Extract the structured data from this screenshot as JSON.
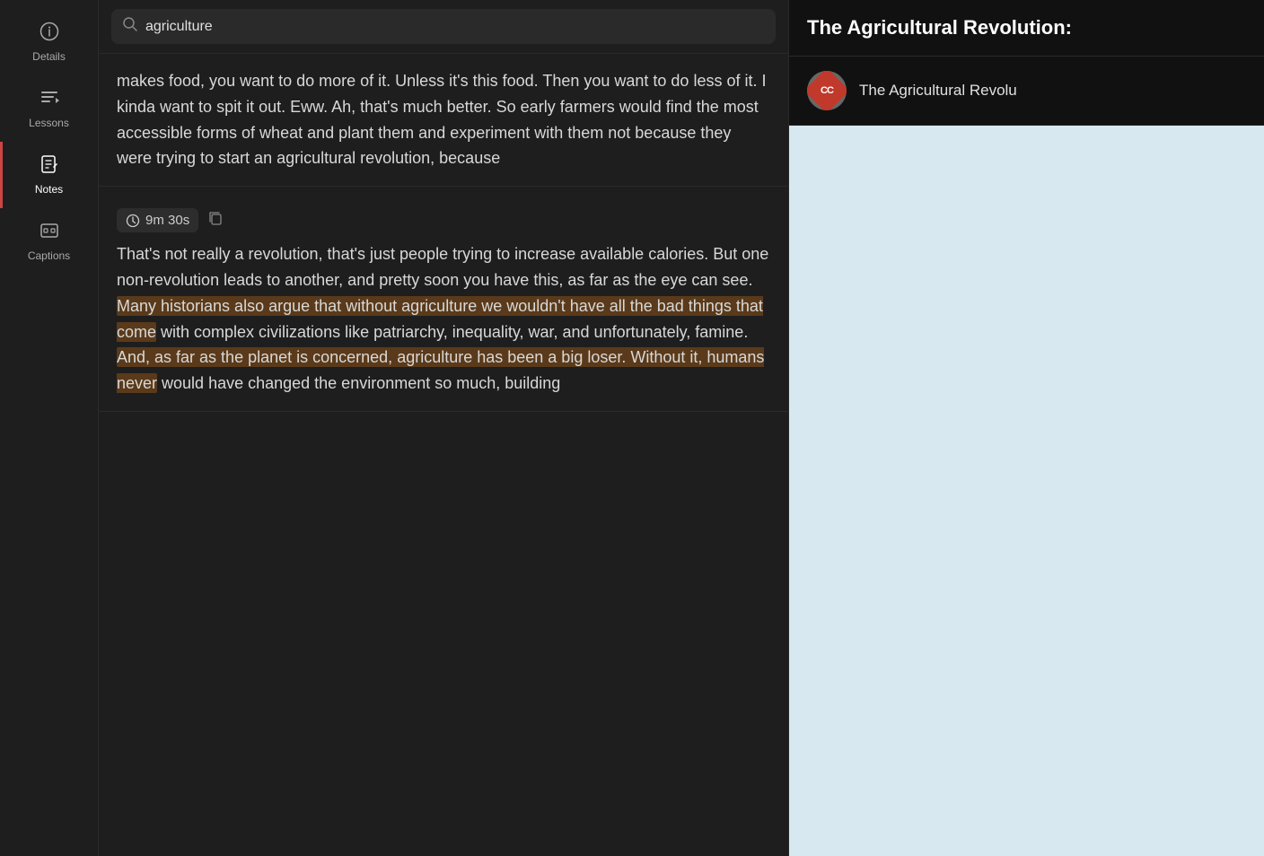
{
  "sidebar": {
    "items": [
      {
        "id": "details",
        "label": "Details",
        "icon": "ℹ",
        "active": false
      },
      {
        "id": "lessons",
        "label": "Lessons",
        "icon": "♫",
        "active": false
      },
      {
        "id": "notes",
        "label": "Notes",
        "icon": "🗒",
        "active": true
      },
      {
        "id": "captions",
        "label": "Captions",
        "icon": "⊟",
        "active": false
      }
    ]
  },
  "search": {
    "placeholder": "agriculture",
    "value": "agriculture"
  },
  "notes": [
    {
      "id": "note1",
      "text": "makes food, you want to do more of it. Unless it's this food. Then you want to do less of it. I kinda want to spit it out. Eww. Ah, that's much better. So early farmers would find the most accessible forms of wheat and plant them and experiment with them not because they were trying to start an agricultural revolution, because",
      "highlighted": false,
      "has_timestamp": false
    },
    {
      "id": "note2",
      "timestamp": "9m 30s",
      "text": "That's not really a revolution, that's just people trying to increase available calories. But one non-revolution leads to another, and pretty soon you have this, as far as the eye can see. Many historians also argue that without agriculture we wouldn't have all the bad things that come with complex civilizations like patriarchy, inequality, war, and unfortunately, famine. And, as far as the planet is concerned, agriculture has been a big loser. Without it, humans never would have changed the environment so much, building",
      "highlighted": true,
      "highlight_start": "Many historians also argue that without agriculture we wouldn't have all the bad things that come",
      "has_timestamp": true
    }
  ],
  "right_panel": {
    "title": "The Agricultural Revolution:",
    "channel_name": "The Agricultural Revolu",
    "channel_initials": "CC"
  }
}
